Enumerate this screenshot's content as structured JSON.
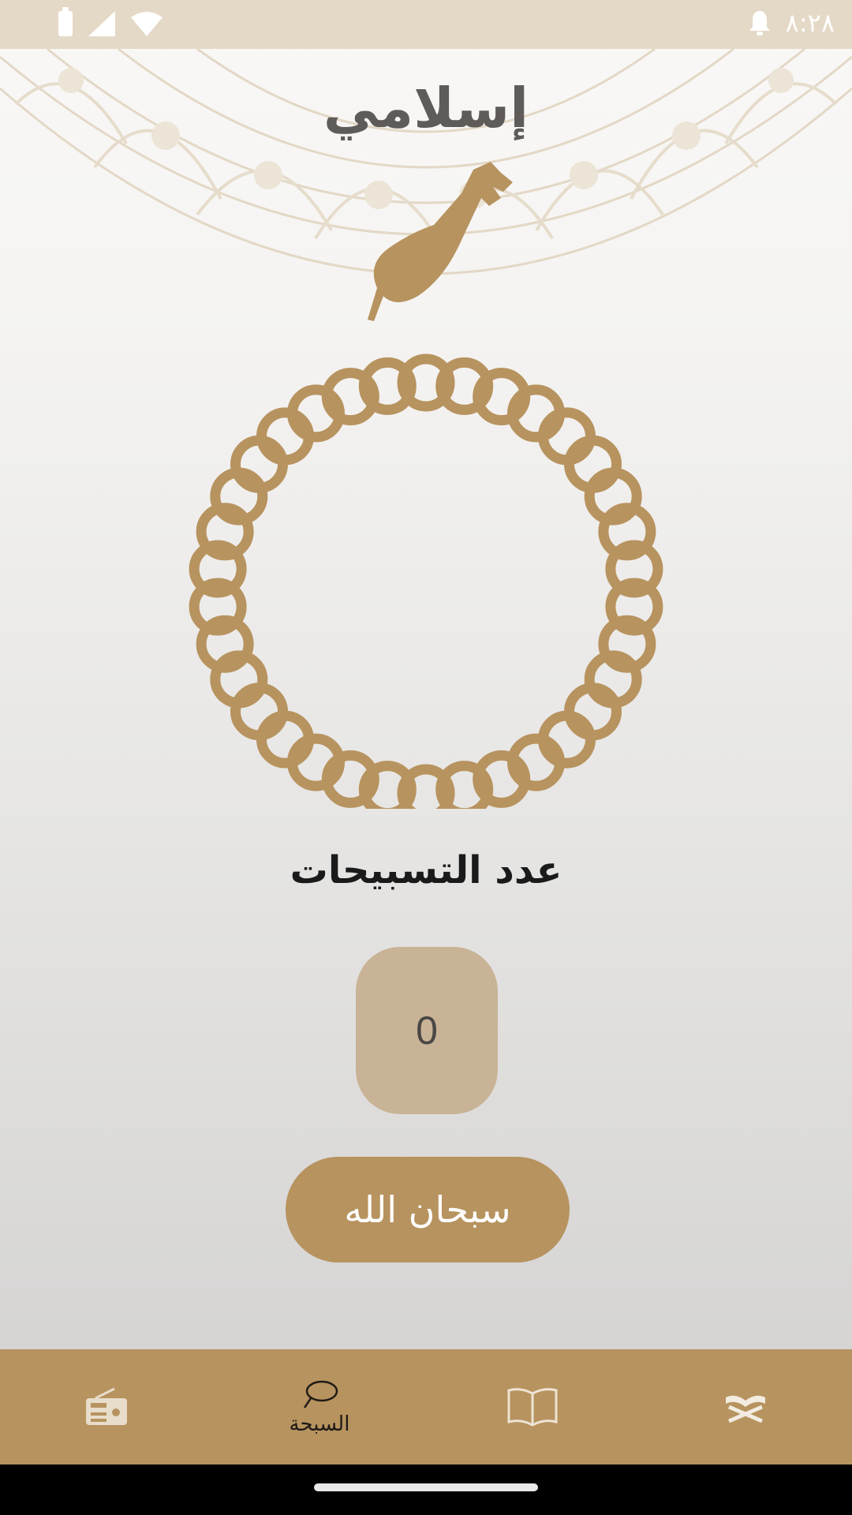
{
  "status_bar": {
    "time": "٨:٢٨",
    "icons": [
      "battery-icon",
      "signal-icon",
      "wifi-icon",
      "notification-bell-icon"
    ]
  },
  "header": {
    "title": "إسلامي"
  },
  "tasbeeh": {
    "count_label": "عدد التسبيحات",
    "count_value": "0",
    "zikr_button_label": "سبحان الله"
  },
  "bottom_nav": {
    "items": [
      {
        "icon": "radio-icon",
        "label": ""
      },
      {
        "icon": "sebha-icon",
        "label": "السبحة",
        "selected": true
      },
      {
        "icon": "hadith-book-icon",
        "label": ""
      },
      {
        "icon": "quran-icon",
        "label": ""
      }
    ]
  },
  "colors": {
    "accent": "#b7935f",
    "counter_bg": "#c9b396",
    "status_bar": "#e4d9c6",
    "title": "#5f5b59"
  }
}
